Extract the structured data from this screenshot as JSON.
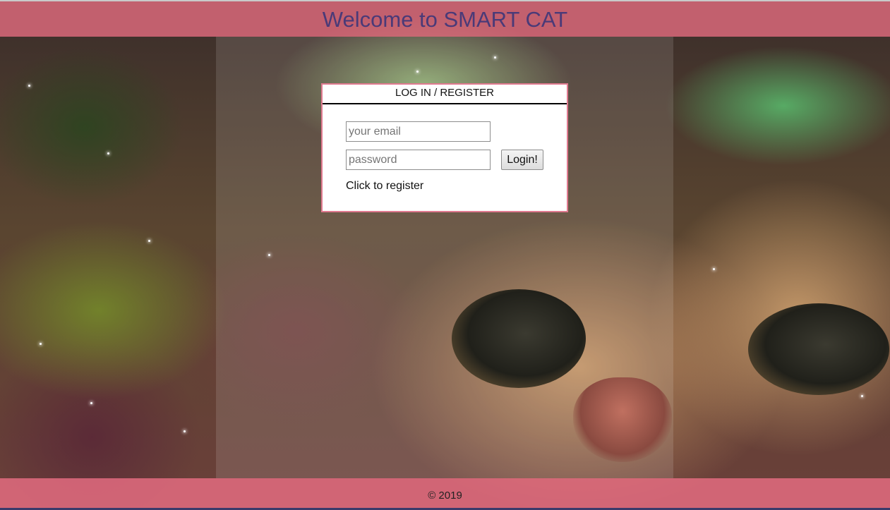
{
  "header": {
    "title": "Welcome to SMART CAT"
  },
  "login": {
    "title": "LOG IN / REGISTER",
    "email_placeholder": "your email",
    "password_placeholder": "password",
    "login_button_label": "Login!",
    "register_link_label": "Click to register"
  },
  "footer": {
    "copyright": "© 2019"
  },
  "colors": {
    "header_bar": "#e86e82",
    "title_text": "#4a3a78",
    "login_border": "#e07a90"
  },
  "background": {
    "image": "space-cat-photo"
  }
}
